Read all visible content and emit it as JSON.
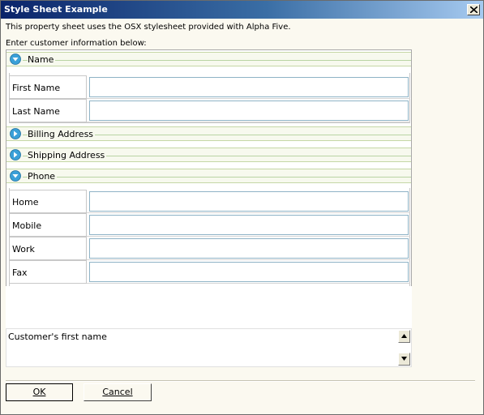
{
  "window": {
    "title": "Style Sheet Example"
  },
  "intro_text": "This property sheet uses the OSX stylesheet provided with Alpha Five.",
  "enter_label": "Enter customer information below:",
  "sections": {
    "name": {
      "label": "Name",
      "state": "expanded",
      "icon": "collapse-arrow-icon"
    },
    "billing": {
      "label": "Billing Address",
      "state": "collapsed",
      "icon": "expand-arrow-icon"
    },
    "shipping": {
      "label": "Shipping Address",
      "state": "collapsed",
      "icon": "expand-arrow-icon"
    },
    "phone": {
      "label": "Phone",
      "state": "expanded",
      "icon": "collapse-arrow-icon"
    }
  },
  "fields": {
    "first_name": {
      "label": "First Name",
      "value": ""
    },
    "last_name": {
      "label": "Last Name",
      "value": ""
    },
    "home": {
      "label": "Home",
      "value": ""
    },
    "mobile": {
      "label": "Mobile",
      "value": ""
    },
    "work": {
      "label": "Work",
      "value": ""
    },
    "fax": {
      "label": "Fax",
      "value": ""
    }
  },
  "description": "Customer's first name",
  "buttons": {
    "ok": "OK",
    "cancel": "Cancel"
  },
  "colors": {
    "title_start": "#0a246a",
    "title_end": "#a6caf0",
    "section_icon": "#3aa0d8",
    "field_border": "#8fb3c6",
    "dialog_bg": "#fbf9f0"
  }
}
